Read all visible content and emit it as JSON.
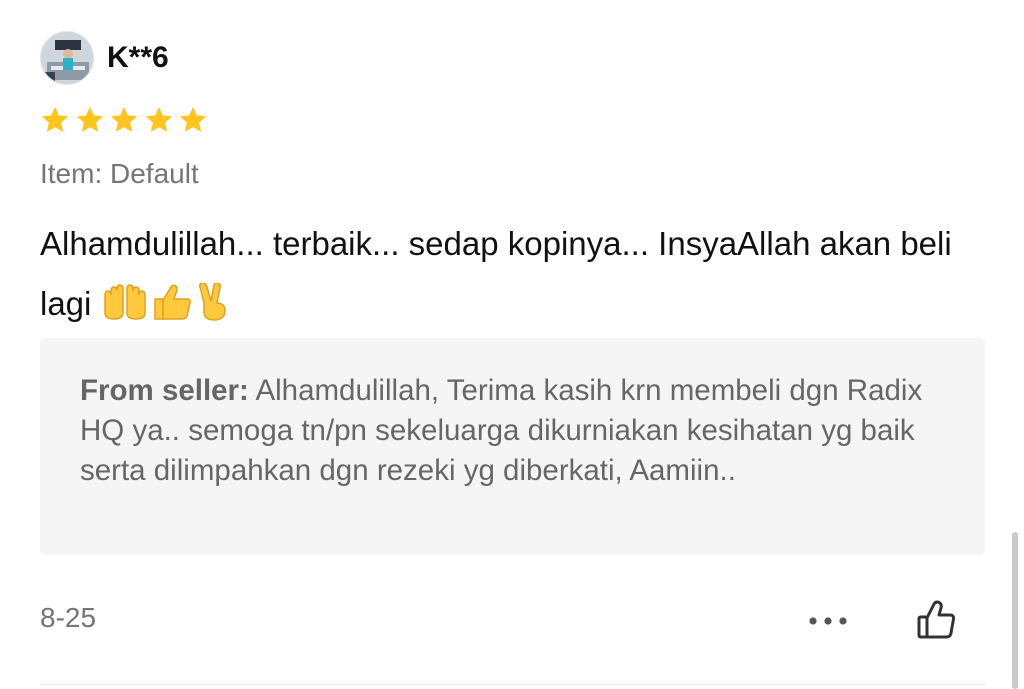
{
  "review": {
    "username": "K**6",
    "rating": 5,
    "rating_max": 5,
    "variation": "Item: Default",
    "comment_text": "Alhamdulillah... terbaik... sedap kopinya... InsyaAllah akan beli lagi ",
    "comment_emojis": [
      "raised-hands-emoji",
      "thumbs-up-emoji",
      "victory-hand-emoji"
    ],
    "seller_reply": {
      "label": "From seller:",
      "text": " Alhamdulillah, Terima kasih krn membeli dgn Radix HQ ya.. semoga tn/pn sekeluarga dikurniakan kesihatan yg baik serta dilimpahkan dgn rezeki yg diberkati, Aamiin.."
    },
    "date": "8-25",
    "icons": {
      "more": "more-dots-icon",
      "like": "thumbs-up-outline-icon",
      "star": "star-icon"
    }
  },
  "colors": {
    "star": "#FFC51E",
    "text_primary": "#111111",
    "text_secondary": "#757575",
    "reply_background": "#F5F5F5",
    "reply_text": "#666666",
    "divider": "#E6E6E6"
  }
}
